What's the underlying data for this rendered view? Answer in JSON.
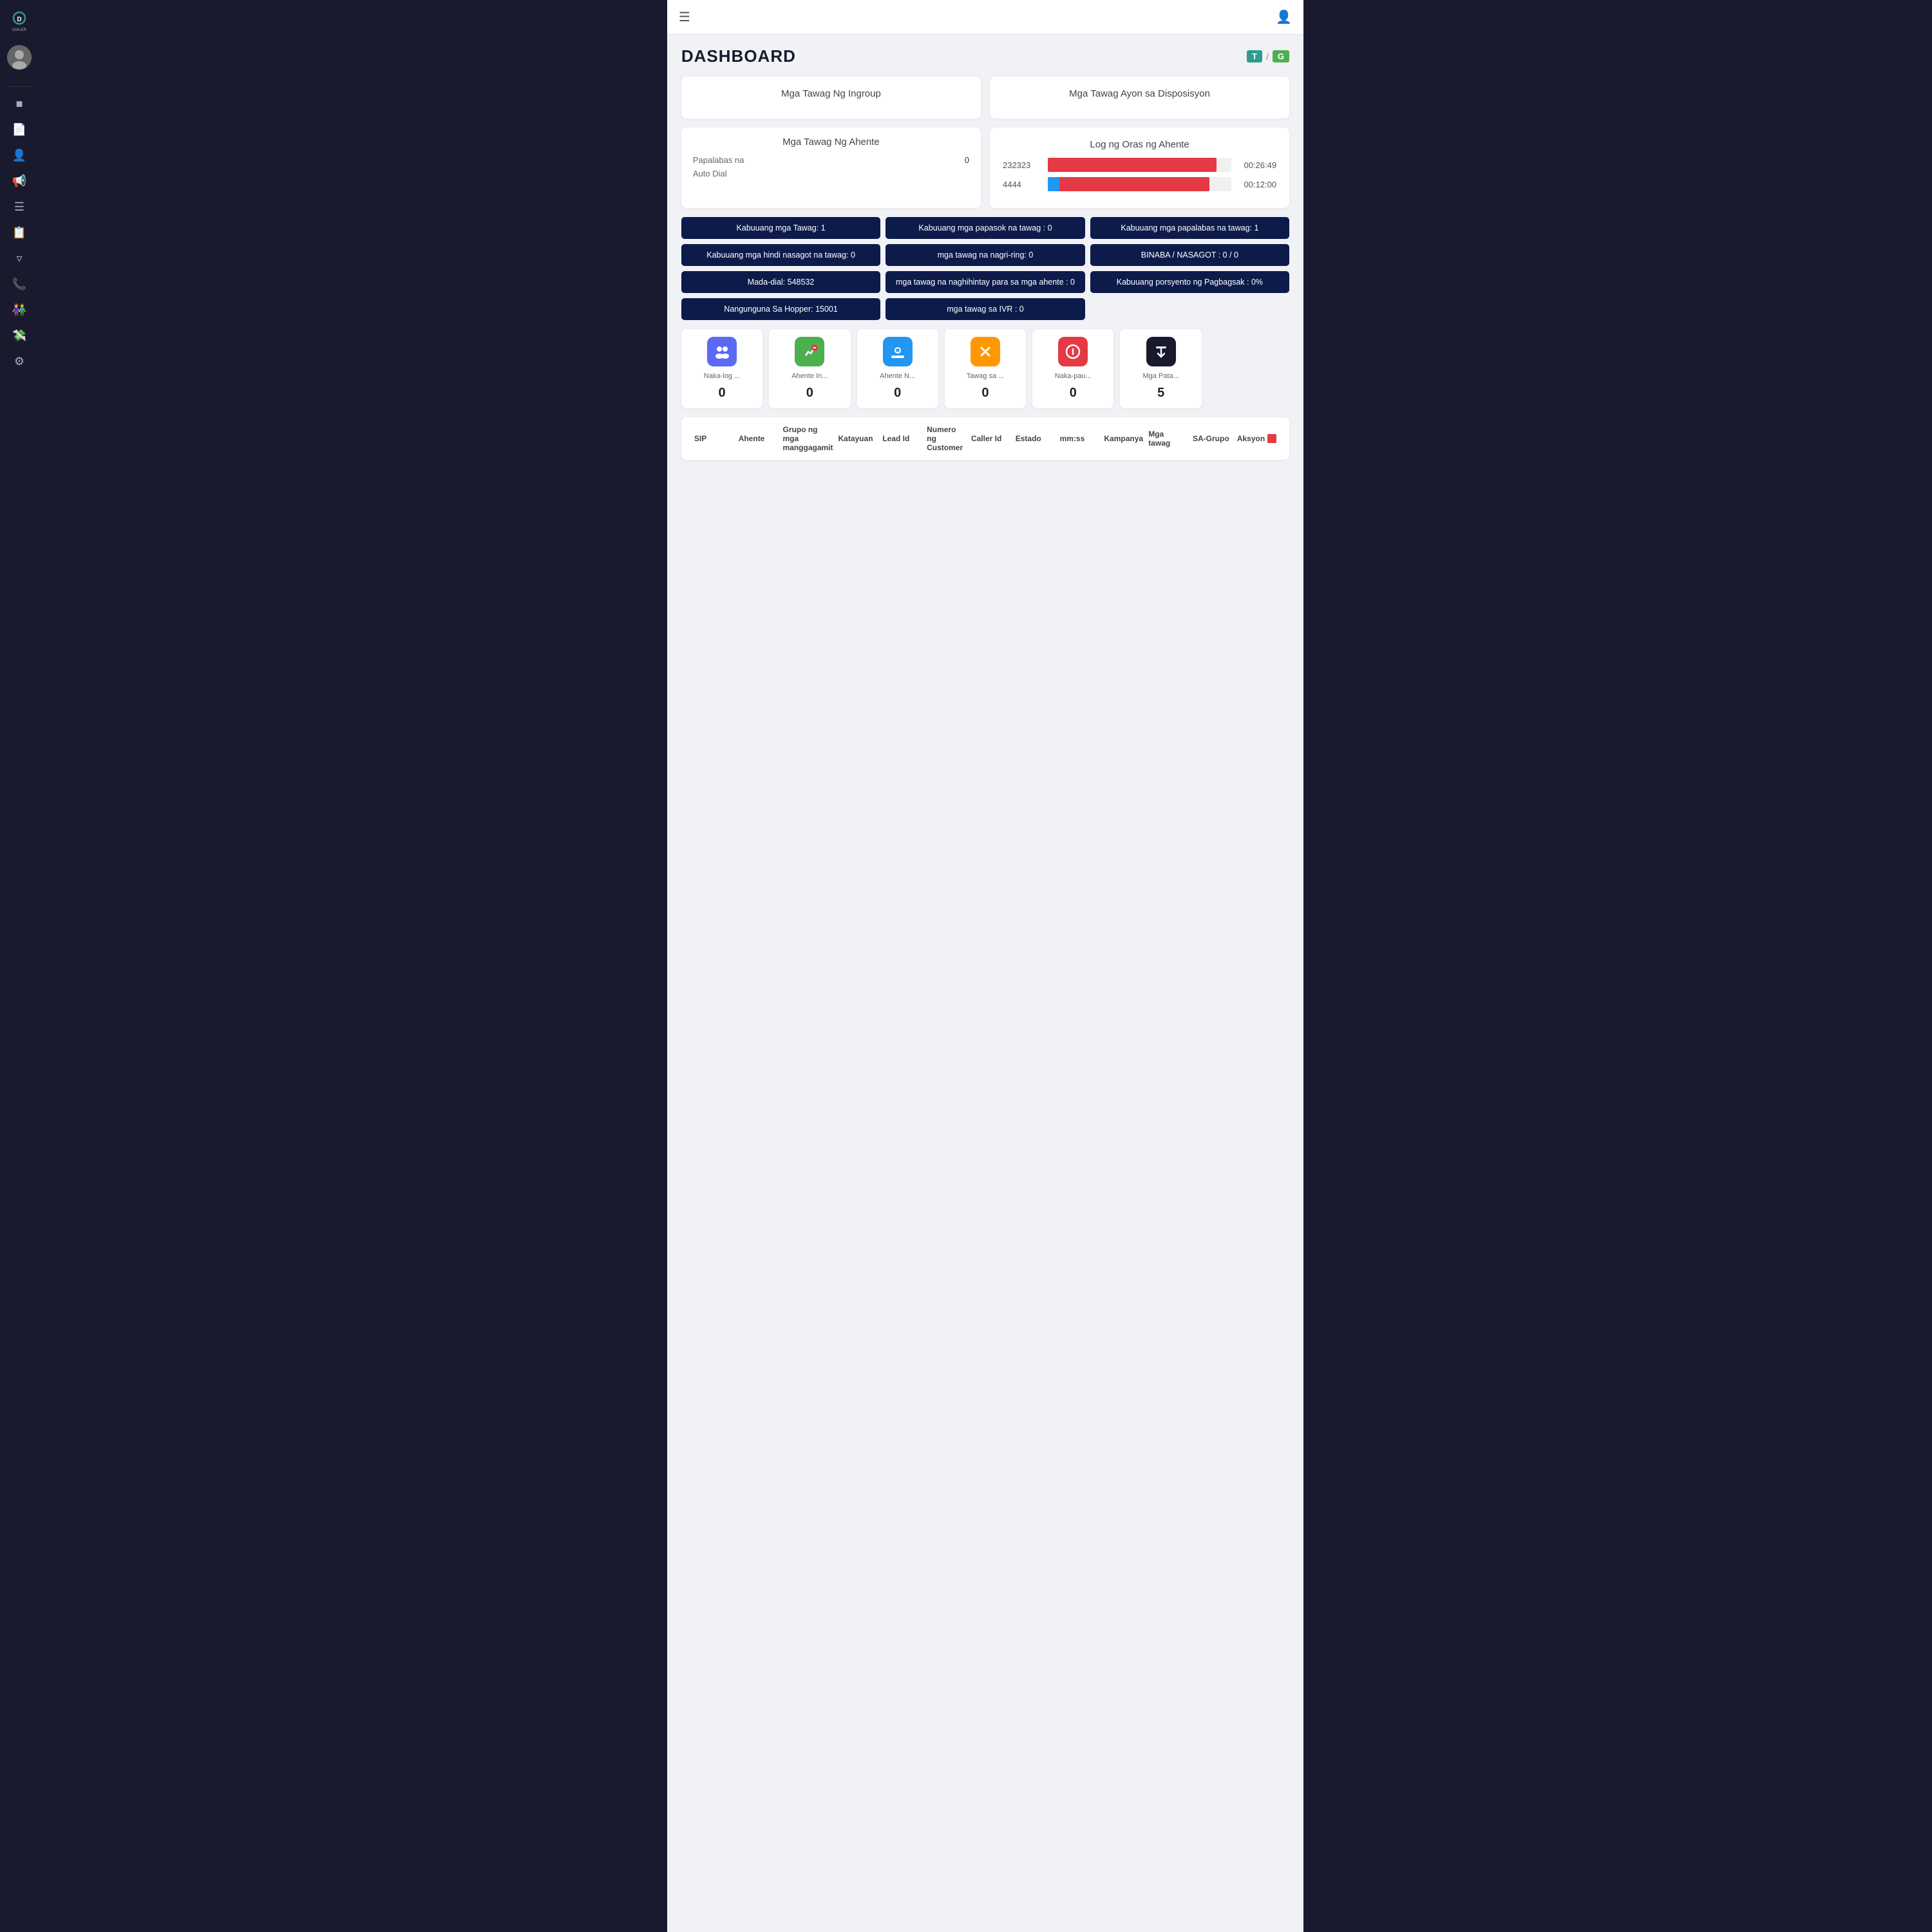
{
  "app": {
    "name": "Dialer",
    "title": "DASHBOARD"
  },
  "topbar": {
    "hamburger_label": "☰",
    "user_icon_label": "👤"
  },
  "header": {
    "title": "DASHBOARD",
    "badge_t": "T",
    "badge_slash": "/",
    "badge_g": "G"
  },
  "cards": {
    "ingroup_title": "Mga Tawag Ng Ingroup",
    "disposition_title": "Mga Tawag Ayon sa Disposisyon",
    "agent_calls_title": "Mga Tawag Ng Ahente",
    "hour_log_title": "Log ng Oras ng Ahente",
    "agent_calls_rows": [
      {
        "label": "Papalabas na",
        "value": "0"
      },
      {
        "label": "Auto Dial",
        "value": ""
      }
    ],
    "hour_log_rows": [
      {
        "id": "232323",
        "bar_width": "92%",
        "bar_type": "red",
        "time": "00:26:49"
      },
      {
        "id": "4444",
        "bar_width": "88%",
        "bar_type": "red_blue",
        "time": "00:12:00"
      }
    ]
  },
  "stats": [
    {
      "label": "Kabuuang mga Tawag: 1"
    },
    {
      "label": "Kabuuang mga papasok na tawag : 0"
    },
    {
      "label": "Kabuuang mga papalabas na tawag: 1"
    },
    {
      "label": "Kabuuang mga hindi nasagot na tawag: 0"
    },
    {
      "label": "mga tawag na nagri-ring: 0"
    },
    {
      "label": "BINABA / NASAGOT : 0 / 0"
    },
    {
      "label": "Mada-dial: 548532"
    },
    {
      "label": "mga tawag na naghihintay para sa mga ahente : 0"
    },
    {
      "label": "Kabuuang porsyento ng Pagbagsak : 0%"
    },
    {
      "label": "Nangunguna Sa Hopper: 15001"
    },
    {
      "label": "mga tawag sa IVR : 0"
    },
    {
      "label": ""
    }
  ],
  "metrics": [
    {
      "icon": "👥",
      "icon_color": "#5b6af5",
      "label": "Naka-log ...",
      "value": "0"
    },
    {
      "icon": "📞",
      "icon_color": "#4caf50",
      "label": "Ahente In...",
      "value": "0"
    },
    {
      "icon": "⏰",
      "icon_color": "#2196f3",
      "label": "Ahente N...",
      "value": "0"
    },
    {
      "icon": "✂",
      "icon_color": "#ff9800",
      "label": "Tawag sa ...",
      "value": "0"
    },
    {
      "icon": "📵",
      "icon_color": "#e63946",
      "label": "Naka-pau...",
      "value": "0"
    },
    {
      "icon": "⬇",
      "icon_color": "#1a1a2e",
      "label": "Mga Pata...",
      "value": "5"
    }
  ],
  "table_columns": [
    "SIP",
    "Ahente",
    "Grupo ng mga manggagamit",
    "Katayuan",
    "Lead Id",
    "Numero ng Customer",
    "Caller Id",
    "Estado",
    "mm:ss",
    "Kampanya",
    "Mga tawag",
    "SA-Grupo",
    "Aksyon"
  ],
  "sidebar": {
    "items": [
      {
        "icon": "👥",
        "name": "users-icon"
      },
      {
        "icon": "📄",
        "name": "reports-icon"
      },
      {
        "icon": "👤",
        "name": "agent-icon"
      },
      {
        "icon": "📢",
        "name": "campaign-icon"
      },
      {
        "icon": "☰",
        "name": "list-icon"
      },
      {
        "icon": "📋",
        "name": "file-icon"
      },
      {
        "icon": "🔧",
        "name": "filter-icon"
      },
      {
        "icon": "📞",
        "name": "phone-icon"
      },
      {
        "icon": "🧑‍🤝‍🧑",
        "name": "contacts-icon"
      },
      {
        "icon": "💰",
        "name": "billing-icon"
      },
      {
        "icon": "⚙",
        "name": "settings-icon"
      }
    ]
  }
}
